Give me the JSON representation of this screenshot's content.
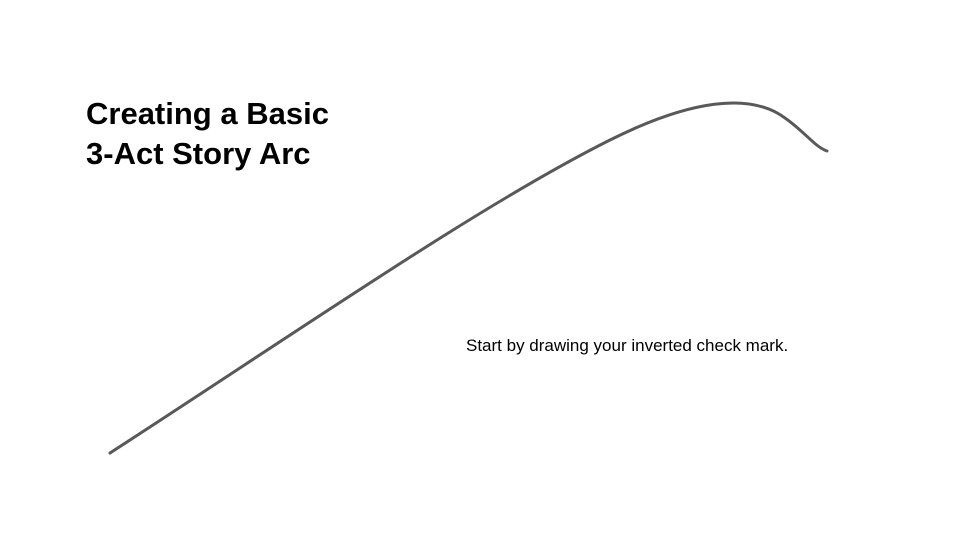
{
  "slide": {
    "title_line1": "Creating a Basic",
    "title_line2": "3-Act Story Arc",
    "caption": "Start by drawing your inverted check mark."
  },
  "colors": {
    "background": "#ffffff",
    "text": "#000000",
    "arc_stroke": "#595959"
  }
}
